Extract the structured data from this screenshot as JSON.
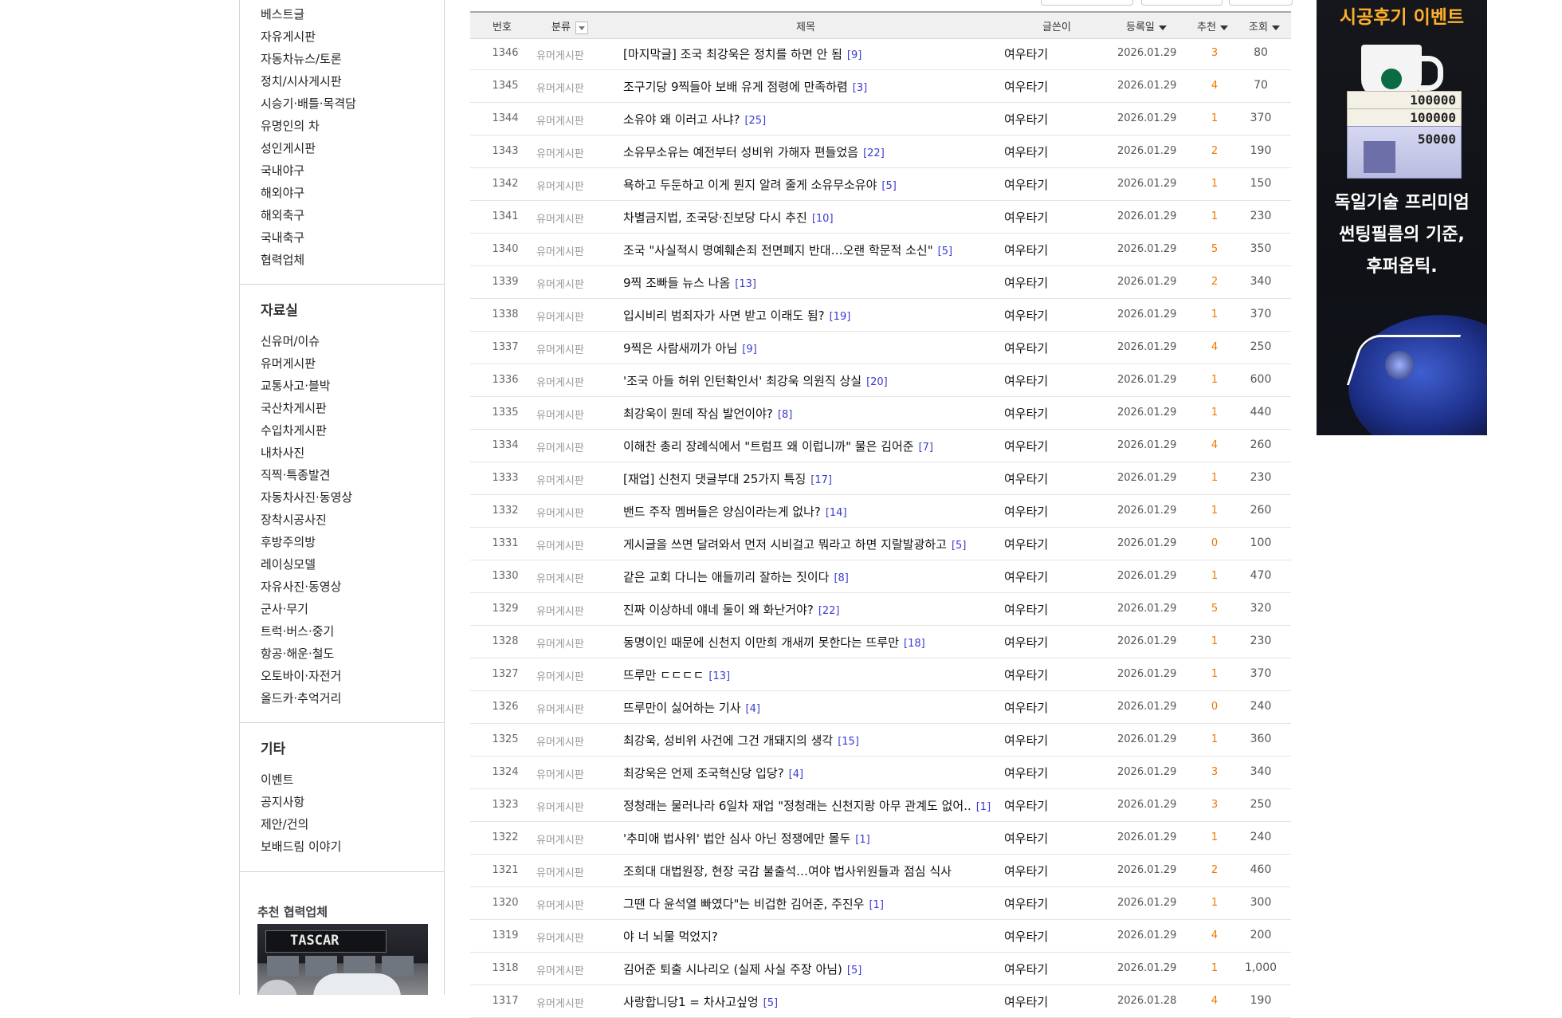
{
  "sidebar": {
    "group1": [
      "베스트글",
      "자유게시판",
      "자동차뉴스/토론",
      "정치/시사게시판",
      "시승기·배틀·목격담",
      "유명인의 차",
      "성인게시판",
      "국내야구",
      "해외야구",
      "해외축구",
      "국내축구",
      "협력업체"
    ],
    "section2_title": "자료실",
    "group2": [
      "신유머/이슈",
      "유머게시판",
      "교통사고·블박",
      "국산차게시판",
      "수입차게시판",
      "내차사진",
      "직찍·특종발견",
      "자동차사진·동영상",
      "장착시공사진",
      "후방주의방",
      "레이싱모델",
      "자유사진·동영상",
      "군사·무기",
      "트럭·버스·중기",
      "항공·해운·철도",
      "오토바이·자전거",
      "올드카·추억거리"
    ],
    "section3_title": "기타",
    "group3": [
      "이벤트",
      "공지사항",
      "제안/건의",
      "보배드림 이야기"
    ],
    "partner_title": "추천 협력업체"
  },
  "table": {
    "headers": {
      "num": "번호",
      "category": "분류",
      "title": "제목",
      "author": "글쓴이",
      "date": "등록일",
      "recommend": "추천",
      "views": "조회"
    },
    "rows": [
      {
        "num": "1346",
        "cat": "유머게시판",
        "title": "[마지막글] 조국 최강욱은 정치를 하면 안 됨",
        "comments": "[9]",
        "author": "여우타기",
        "date": "2026.01.29",
        "rec": "3",
        "views": "80"
      },
      {
        "num": "1345",
        "cat": "유머게시판",
        "title": "조구기당 9찍들아 보배 유게 점령에 만족하렴",
        "comments": "[3]",
        "author": "여우타기",
        "date": "2026.01.29",
        "rec": "4",
        "views": "70"
      },
      {
        "num": "1344",
        "cat": "유머게시판",
        "title": "소유야 왜 이러고 사냐?",
        "comments": "[25]",
        "author": "여우타기",
        "date": "2026.01.29",
        "rec": "1",
        "views": "370"
      },
      {
        "num": "1343",
        "cat": "유머게시판",
        "title": "소유무소유는 예전부터 성비위 가해자 편들었음",
        "comments": "[22]",
        "author": "여우타기",
        "date": "2026.01.29",
        "rec": "2",
        "views": "190"
      },
      {
        "num": "1342",
        "cat": "유머게시판",
        "title": "욕하고 두둔하고 이게 뭔지 알려 줄게 소유무소유야",
        "comments": "[5]",
        "author": "여우타기",
        "date": "2026.01.29",
        "rec": "1",
        "views": "150"
      },
      {
        "num": "1341",
        "cat": "유머게시판",
        "title": "차별금지법, 조국당·진보당 다시 추진",
        "comments": "[10]",
        "author": "여우타기",
        "date": "2026.01.29",
        "rec": "1",
        "views": "230"
      },
      {
        "num": "1340",
        "cat": "유머게시판",
        "title": "조국 \"사실적시 명예훼손죄 전면폐지 반대…오랜 학문적 소신\"",
        "comments": "[5]",
        "author": "여우타기",
        "date": "2026.01.29",
        "rec": "5",
        "views": "350"
      },
      {
        "num": "1339",
        "cat": "유머게시판",
        "title": "9찍 조빠들 뉴스 나옴",
        "comments": "[13]",
        "author": "여우타기",
        "date": "2026.01.29",
        "rec": "2",
        "views": "340"
      },
      {
        "num": "1338",
        "cat": "유머게시판",
        "title": "입시비리 범죄자가 사면 받고 이래도 됨?",
        "comments": "[19]",
        "author": "여우타기",
        "date": "2026.01.29",
        "rec": "1",
        "views": "370"
      },
      {
        "num": "1337",
        "cat": "유머게시판",
        "title": "9찍은 사람새끼가 아님",
        "comments": "[9]",
        "author": "여우타기",
        "date": "2026.01.29",
        "rec": "4",
        "views": "250"
      },
      {
        "num": "1336",
        "cat": "유머게시판",
        "title": "'조국 아들 허위 인턴확인서' 최강욱 의원직 상실",
        "comments": "[20]",
        "author": "여우타기",
        "date": "2026.01.29",
        "rec": "1",
        "views": "600"
      },
      {
        "num": "1335",
        "cat": "유머게시판",
        "title": "최강욱이 뭔데 작심 발언이야?",
        "comments": "[8]",
        "author": "여우타기",
        "date": "2026.01.29",
        "rec": "1",
        "views": "440"
      },
      {
        "num": "1334",
        "cat": "유머게시판",
        "title": "이해찬 총리 장례식에서 \"트럼프 왜 이럽니까\" 물은 김어준",
        "comments": "[7]",
        "author": "여우타기",
        "date": "2026.01.29",
        "rec": "4",
        "views": "260"
      },
      {
        "num": "1333",
        "cat": "유머게시판",
        "title": "[재업] 신천지 댓글부대 25가지 특징",
        "comments": "[17]",
        "author": "여우타기",
        "date": "2026.01.29",
        "rec": "1",
        "views": "230"
      },
      {
        "num": "1332",
        "cat": "유머게시판",
        "title": "밴드 주작 멤버들은 양심이라는게 없나?",
        "comments": "[14]",
        "author": "여우타기",
        "date": "2026.01.29",
        "rec": "1",
        "views": "260"
      },
      {
        "num": "1331",
        "cat": "유머게시판",
        "title": "게시글을 쓰면 달려와서 먼저 시비걸고 뭐라고 하면 지랄발광하고",
        "comments": "[5]",
        "author": "여우타기",
        "date": "2026.01.29",
        "rec": "0",
        "views": "100"
      },
      {
        "num": "1330",
        "cat": "유머게시판",
        "title": "같은 교회 다니는 애들끼리 잘하는 짓이다",
        "comments": "[8]",
        "author": "여우타기",
        "date": "2026.01.29",
        "rec": "1",
        "views": "470"
      },
      {
        "num": "1329",
        "cat": "유머게시판",
        "title": "진짜 이상하네 얘네 둘이 왜 화난거야?",
        "comments": "[22]",
        "author": "여우타기",
        "date": "2026.01.29",
        "rec": "5",
        "views": "320"
      },
      {
        "num": "1328",
        "cat": "유머게시판",
        "title": "동명이인 때문에 신천지 이만희 개새끼 못한다는 뜨루만",
        "comments": "[18]",
        "author": "여우타기",
        "date": "2026.01.29",
        "rec": "1",
        "views": "230"
      },
      {
        "num": "1327",
        "cat": "유머게시판",
        "title": "뜨루만 ㄷㄷㄷㄷ",
        "comments": "[13]",
        "author": "여우타기",
        "date": "2026.01.29",
        "rec": "1",
        "views": "370"
      },
      {
        "num": "1326",
        "cat": "유머게시판",
        "title": "뜨루만이 싫어하는 기사",
        "comments": "[4]",
        "author": "여우타기",
        "date": "2026.01.29",
        "rec": "0",
        "views": "240"
      },
      {
        "num": "1325",
        "cat": "유머게시판",
        "title": "최강욱, 성비위 사건에 그건 개돼지의 생각",
        "comments": "[15]",
        "author": "여우타기",
        "date": "2026.01.29",
        "rec": "1",
        "views": "360"
      },
      {
        "num": "1324",
        "cat": "유머게시판",
        "title": "최강욱은 언제 조국혁신당 입당?",
        "comments": "[4]",
        "author": "여우타기",
        "date": "2026.01.29",
        "rec": "3",
        "views": "340"
      },
      {
        "num": "1323",
        "cat": "유머게시판",
        "title": "정청래는 물러나라 6일차 재업 \"정청래는 신천지랑 아무 관계도 없어..",
        "comments": "[1]",
        "author": "여우타기",
        "date": "2026.01.29",
        "rec": "3",
        "views": "250"
      },
      {
        "num": "1322",
        "cat": "유머게시판",
        "title": "'추미애 법사위' 법안 심사 아닌 정쟁에만 몰두",
        "comments": "[1]",
        "author": "여우타기",
        "date": "2026.01.29",
        "rec": "1",
        "views": "240"
      },
      {
        "num": "1321",
        "cat": "유머게시판",
        "title": "조희대 대법원장, 현장 국감 불출석…여야 법사위원들과 점심 식사",
        "comments": "",
        "author": "여우타기",
        "date": "2026.01.29",
        "rec": "2",
        "views": "460"
      },
      {
        "num": "1320",
        "cat": "유머게시판",
        "title": "그땐 다 윤석열 빠였다\"는 비겁한 김어준, 주진우",
        "comments": "[1]",
        "author": "여우타기",
        "date": "2026.01.29",
        "rec": "1",
        "views": "300"
      },
      {
        "num": "1319",
        "cat": "유머게시판",
        "title": "야 너 뇌물 먹었지?",
        "comments": "",
        "author": "여우타기",
        "date": "2026.01.29",
        "rec": "4",
        "views": "200"
      },
      {
        "num": "1318",
        "cat": "유머게시판",
        "title": "김어준 퇴출 시나리오 (실제 사실 주장 아님)",
        "comments": "[5]",
        "author": "여우타기",
        "date": "2026.01.29",
        "rec": "1",
        "views": "1,000"
      },
      {
        "num": "1317",
        "cat": "유머게시판",
        "title": "사랑합니당1 = 차사고싶엉",
        "comments": "[5]",
        "author": "여우타기",
        "date": "2026.01.28",
        "rec": "4",
        "views": "190"
      }
    ]
  },
  "ad": {
    "headline": "시공후기 이벤트",
    "voucher1": "100000",
    "voucher2": "100000",
    "voucher3": "50000",
    "line1": "독일기술 프리미엄",
    "line2": "썬팅필름의 기준,",
    "line3": "후퍼옵틱."
  },
  "partner_sign": "TASCAR",
  "colors": {
    "recommend": "#f07800",
    "comment_count": "#3a3ad0",
    "ad_headline": "#ffb02b"
  }
}
